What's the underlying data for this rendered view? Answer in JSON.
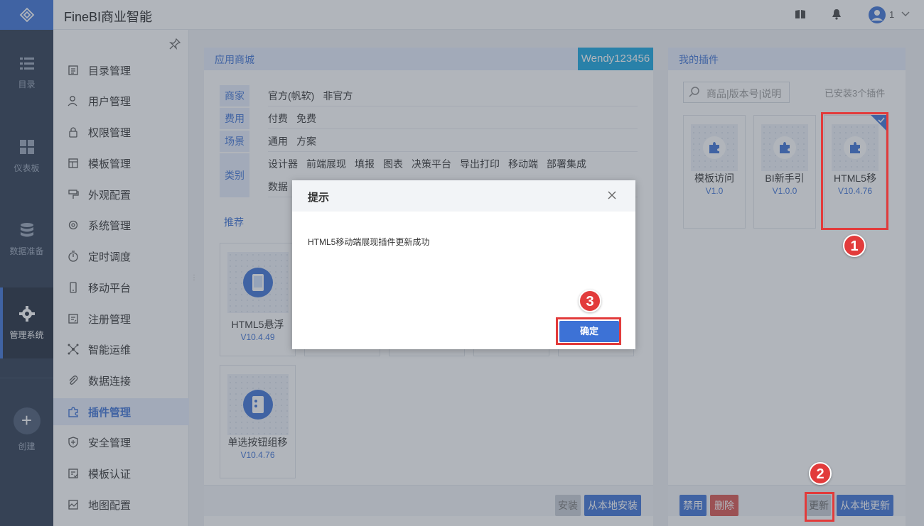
{
  "app": {
    "title": "FineBI商业智能",
    "user_number": "1"
  },
  "rail": {
    "items": [
      {
        "label": "目录"
      },
      {
        "label": "仪表板"
      },
      {
        "label": "数据准备"
      },
      {
        "label": "管理系统"
      },
      {
        "label": "创建"
      }
    ]
  },
  "submenu": {
    "items": [
      {
        "label": "目录管理"
      },
      {
        "label": "用户管理"
      },
      {
        "label": "权限管理"
      },
      {
        "label": "模板管理"
      },
      {
        "label": "外观配置"
      },
      {
        "label": "系统管理"
      },
      {
        "label": "定时调度"
      },
      {
        "label": "移动平台"
      },
      {
        "label": "注册管理"
      },
      {
        "label": "智能运维"
      },
      {
        "label": "数据连接"
      },
      {
        "label": "插件管理"
      },
      {
        "label": "安全管理"
      },
      {
        "label": "模板认证"
      },
      {
        "label": "地图配置"
      }
    ]
  },
  "store": {
    "title": "应用商城",
    "user_tag": "Wendy123456",
    "filters": [
      {
        "label": "商家",
        "options": [
          "官方(帆软)",
          "非官方"
        ]
      },
      {
        "label": "费用",
        "options": [
          "付费",
          "免费"
        ]
      },
      {
        "label": "场景",
        "options": [
          "通用",
          "方案"
        ]
      },
      {
        "label": "类别",
        "options": [
          "设计器",
          "前端展现",
          "填报",
          "图表",
          "决策平台",
          "导出打印",
          "移动端",
          "部署集成"
        ],
        "options2": [
          "数据"
        ]
      }
    ],
    "recommend_label": "推荐",
    "cards": [
      {
        "name": "HTML5悬浮",
        "version": "V10.4.49"
      },
      {
        "name": "单选按钮组移",
        "version": "V10.4.76"
      }
    ],
    "install_button": "安装",
    "install_local_button": "从本地安装"
  },
  "my_plugins": {
    "title": "我的插件",
    "search_placeholder": "商品|版本号|说明",
    "installed_count": "已安装3个插件",
    "cards": [
      {
        "name": "模板访问",
        "version": "V1.0"
      },
      {
        "name": "BI新手引",
        "version": "V1.0.0"
      },
      {
        "name": "HTML5移",
        "version": "V10.4.76"
      }
    ],
    "disable_button": "禁用",
    "delete_button": "删除",
    "update_button": "更新",
    "update_local_button": "从本地更新"
  },
  "dialog": {
    "title": "提示",
    "message": "HTML5移动端展现插件更新成功",
    "ok_button": "确定"
  },
  "annotations": {
    "badge1": "1",
    "badge2": "2",
    "badge3": "3"
  },
  "colors": {
    "accent": "#3d72d6",
    "rail_bg": "#2c3a50",
    "highlight": "#e23b3b",
    "delete": "#d9534f"
  }
}
